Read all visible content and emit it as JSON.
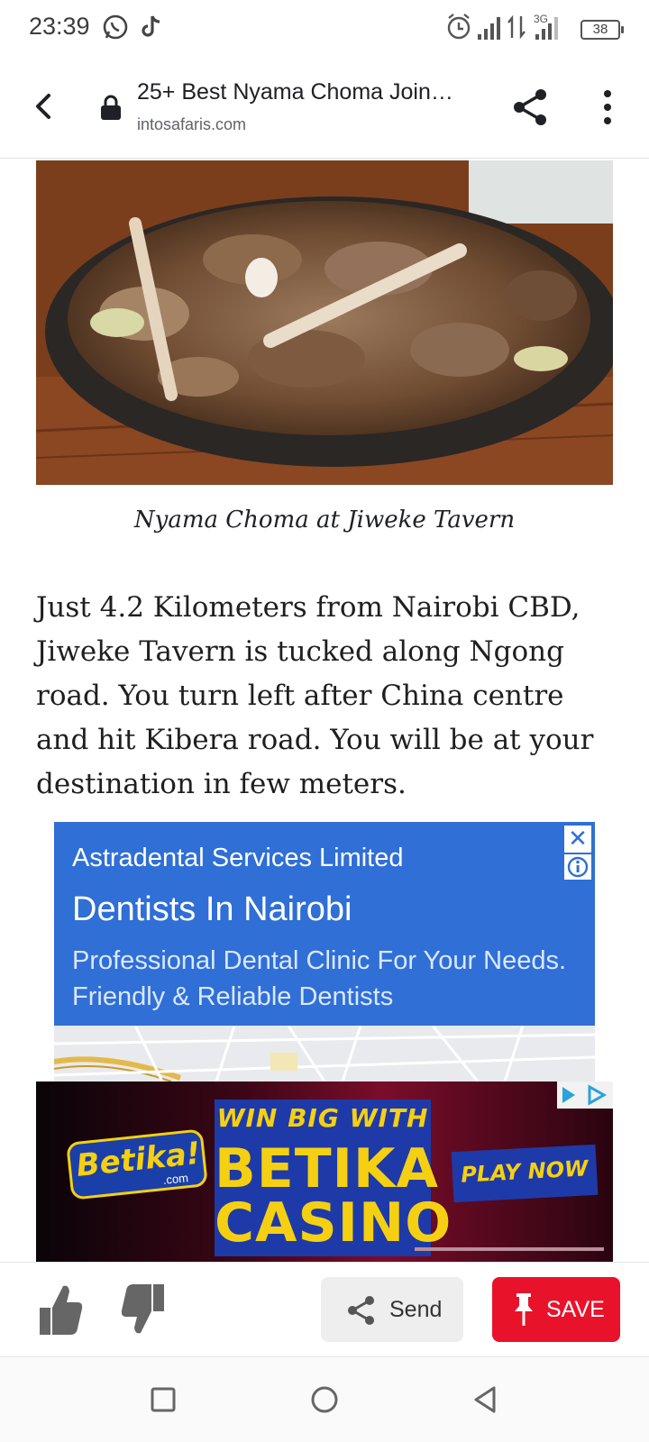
{
  "status_bar": {
    "time": "23:39",
    "network": "3G",
    "battery": "38",
    "icons": [
      "whatsapp-icon",
      "tiktok-icon",
      "alarm-icon",
      "signal-icon",
      "data-arrows-icon",
      "signal-3g-icon",
      "battery-icon"
    ]
  },
  "toolbar": {
    "title": "25+ Best Nyama Choma Join…",
    "url": "intosafaris.com"
  },
  "article": {
    "caption": "Nyama Choma at Jiweke Tavern",
    "paragraph": "Just 4.2 Kilometers from Nairobi CBD, Jiweke Tavern is tucked along Ngong road. You turn left after China centre and hit Kibera road. You will be at your destination in few meters."
  },
  "ad_dental": {
    "advertiser": "Astradental Services Limited",
    "headline": "Dentists In Nairobi",
    "description": "Professional Dental Clinic For Your Needs. Friendly & Reliable Dentists",
    "close_symbol": "✕",
    "color": "#2f6fd6"
  },
  "ad_betika": {
    "logo": "Betika!",
    "logo_sub": ".com",
    "line1": "WIN BIG WITH",
    "line2": "BETIKA",
    "line3": "CASINO",
    "cta": "PLAY NOW"
  },
  "actions": {
    "send_label": "Send",
    "save_label": "SAVE",
    "save_color": "#e8132b"
  }
}
